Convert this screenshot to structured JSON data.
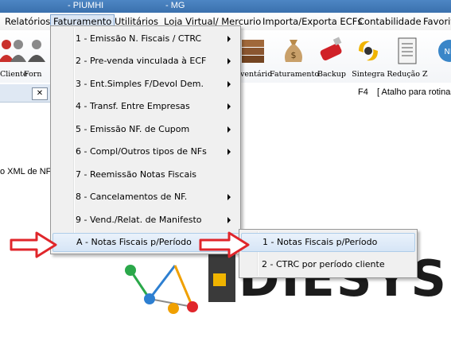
{
  "titlebar": {
    "left_text": "- PIUMHI",
    "right_text": "- MG"
  },
  "menubar": {
    "items": [
      "Relatórios",
      "Faturamento",
      "Utilitários",
      "Loja Virtual/ Mercurio",
      "Importa/Exporta ECFs",
      "Contabilidade",
      "Favorit"
    ]
  },
  "toolbar": {
    "left_labels": [
      "Cliente",
      "Forn"
    ],
    "right_labels": [
      "ventário",
      "Faturamento",
      "Backup",
      "Sintegra",
      "Redução Z",
      "NF"
    ]
  },
  "hint": {
    "key": "F4",
    "text": "[  Atalho para rotinas"
  },
  "left_panel": {
    "close_glyph": "✕",
    "partial_text": "o XML de NF"
  },
  "menu": {
    "items": [
      {
        "label": "1 - Emissão N. Fiscais / CTRC",
        "has_submenu": true
      },
      {
        "label": "2 - Pre-venda vinculada à ECF",
        "has_submenu": true
      },
      {
        "label": "3 - Ent.Simples F/Devol Dem.",
        "has_submenu": true
      },
      {
        "label": "4 - Transf. Entre Empresas",
        "has_submenu": true
      },
      {
        "label": "5 - Emissão NF. de Cupom",
        "has_submenu": true
      },
      {
        "label": "6 - Compl/Outros tipos de NFs",
        "has_submenu": true
      },
      {
        "label": "7 - Reemissão Notas Fiscais",
        "has_submenu": false
      },
      {
        "label": "8 - Cancelamentos de NF.",
        "has_submenu": true
      },
      {
        "label": "9 - Vend./Relat. de Manifesto",
        "has_submenu": true
      },
      {
        "label": "A - Notas Fiscais p/Período",
        "has_submenu": true
      }
    ]
  },
  "submenu": {
    "items": [
      "1 - Notas Fiscais p/Período",
      "2 - CTRC por período cliente"
    ]
  },
  "logo": {
    "text": "DIESYS"
  },
  "colors": {
    "arrow_red": "#e0262b",
    "highlight": "#d6e5f6",
    "menu_bg": "#f0f0f0"
  }
}
